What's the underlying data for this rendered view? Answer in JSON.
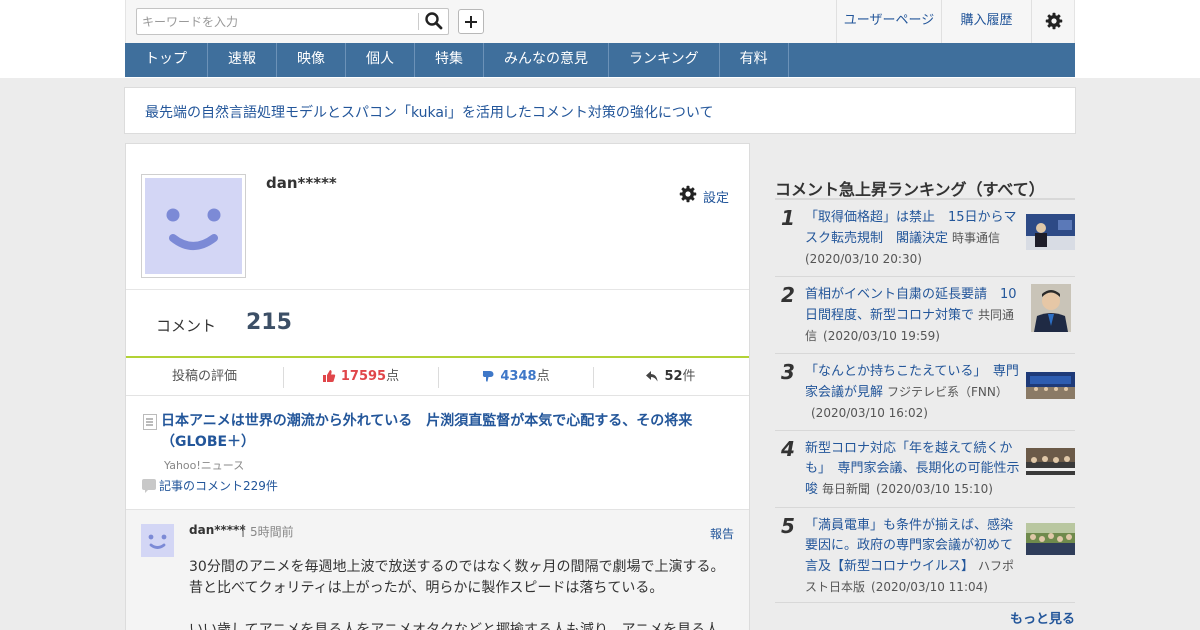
{
  "header": {
    "search_placeholder": "キーワードを入力",
    "user_page": "ユーザーページ",
    "purchase_history": "購入履歴"
  },
  "nav": [
    "トップ",
    "速報",
    "映像",
    "個人",
    "特集",
    "みんなの意見",
    "ランキング",
    "有料"
  ],
  "notice": "最先端の自然言語処理モデルとスパコン「kukai」を活用したコメント対策の強化について",
  "profile": {
    "username": "dan*****",
    "settings_label": "設定",
    "comment_label": "コメント",
    "comment_count": "215",
    "eval_label": "投稿の評価",
    "good_count": "17595",
    "bad_count": "4348",
    "points_unit": "点",
    "reply_count": "52",
    "reply_unit": "件"
  },
  "article": {
    "title": "日本アニメは世界の潮流から外れている　片渕須直監督が本気で心配する、その将来（GLOBE＋）",
    "source": "Yahoo!ニュース",
    "comments_link": "記事のコメント229件"
  },
  "comment": {
    "user": "dan*****",
    "separator": "|",
    "time": "5時間前",
    "report": "報告",
    "line1": "30分間のアニメを毎週地上波で放送するのではなく数ヶ月の間隔で劇場で上演する。",
    "line2": "昔と比べてクォリティは上がったが、明らかに製作スピードは落ちている。",
    "line3": "いい歳してアニメを見る人をアニメオタクなどと揶揄する人も減り、アニメを見る人"
  },
  "sidebar": {
    "title": "コメント急上昇ランキング（すべて）",
    "more": "もっと見る",
    "items": [
      {
        "rank": "1",
        "title": "「取得価格超」は禁止　15日からマスク転売規制　閣議決定",
        "source": "時事通信",
        "date": "(2020/03/10 20:30)"
      },
      {
        "rank": "2",
        "title": "首相がイベント自粛の延長要請　10日間程度、新型コロナ対策で",
        "source": "共同通信",
        "date": "(2020/03/10 19:59)"
      },
      {
        "rank": "3",
        "title": "「なんとか持ちこたえている」　専門家会議が見解",
        "source": "フジテレビ系（FNN）",
        "date": "(2020/03/10 16:02)"
      },
      {
        "rank": "4",
        "title": "新型コロナ対応「年を越えて続くかも」　専門家会議、長期化の可能性示唆",
        "source": "毎日新聞",
        "date": "(2020/03/10 15:10)"
      },
      {
        "rank": "5",
        "title": "「満員電車」も条件が揃えば、感染要因に。政府の専門家会議が初めて言及【新型コロナウイルス】",
        "source": "ハフポスト日本版",
        "date": "(2020/03/10 11:04)"
      }
    ]
  },
  "colors": {
    "nav_bg": "#3f6f9c",
    "link": "#23569a",
    "good": "#e0464a",
    "bad": "#3f78c8",
    "green_rule": "#b2d235",
    "avatar": "#d3d6f5"
  }
}
